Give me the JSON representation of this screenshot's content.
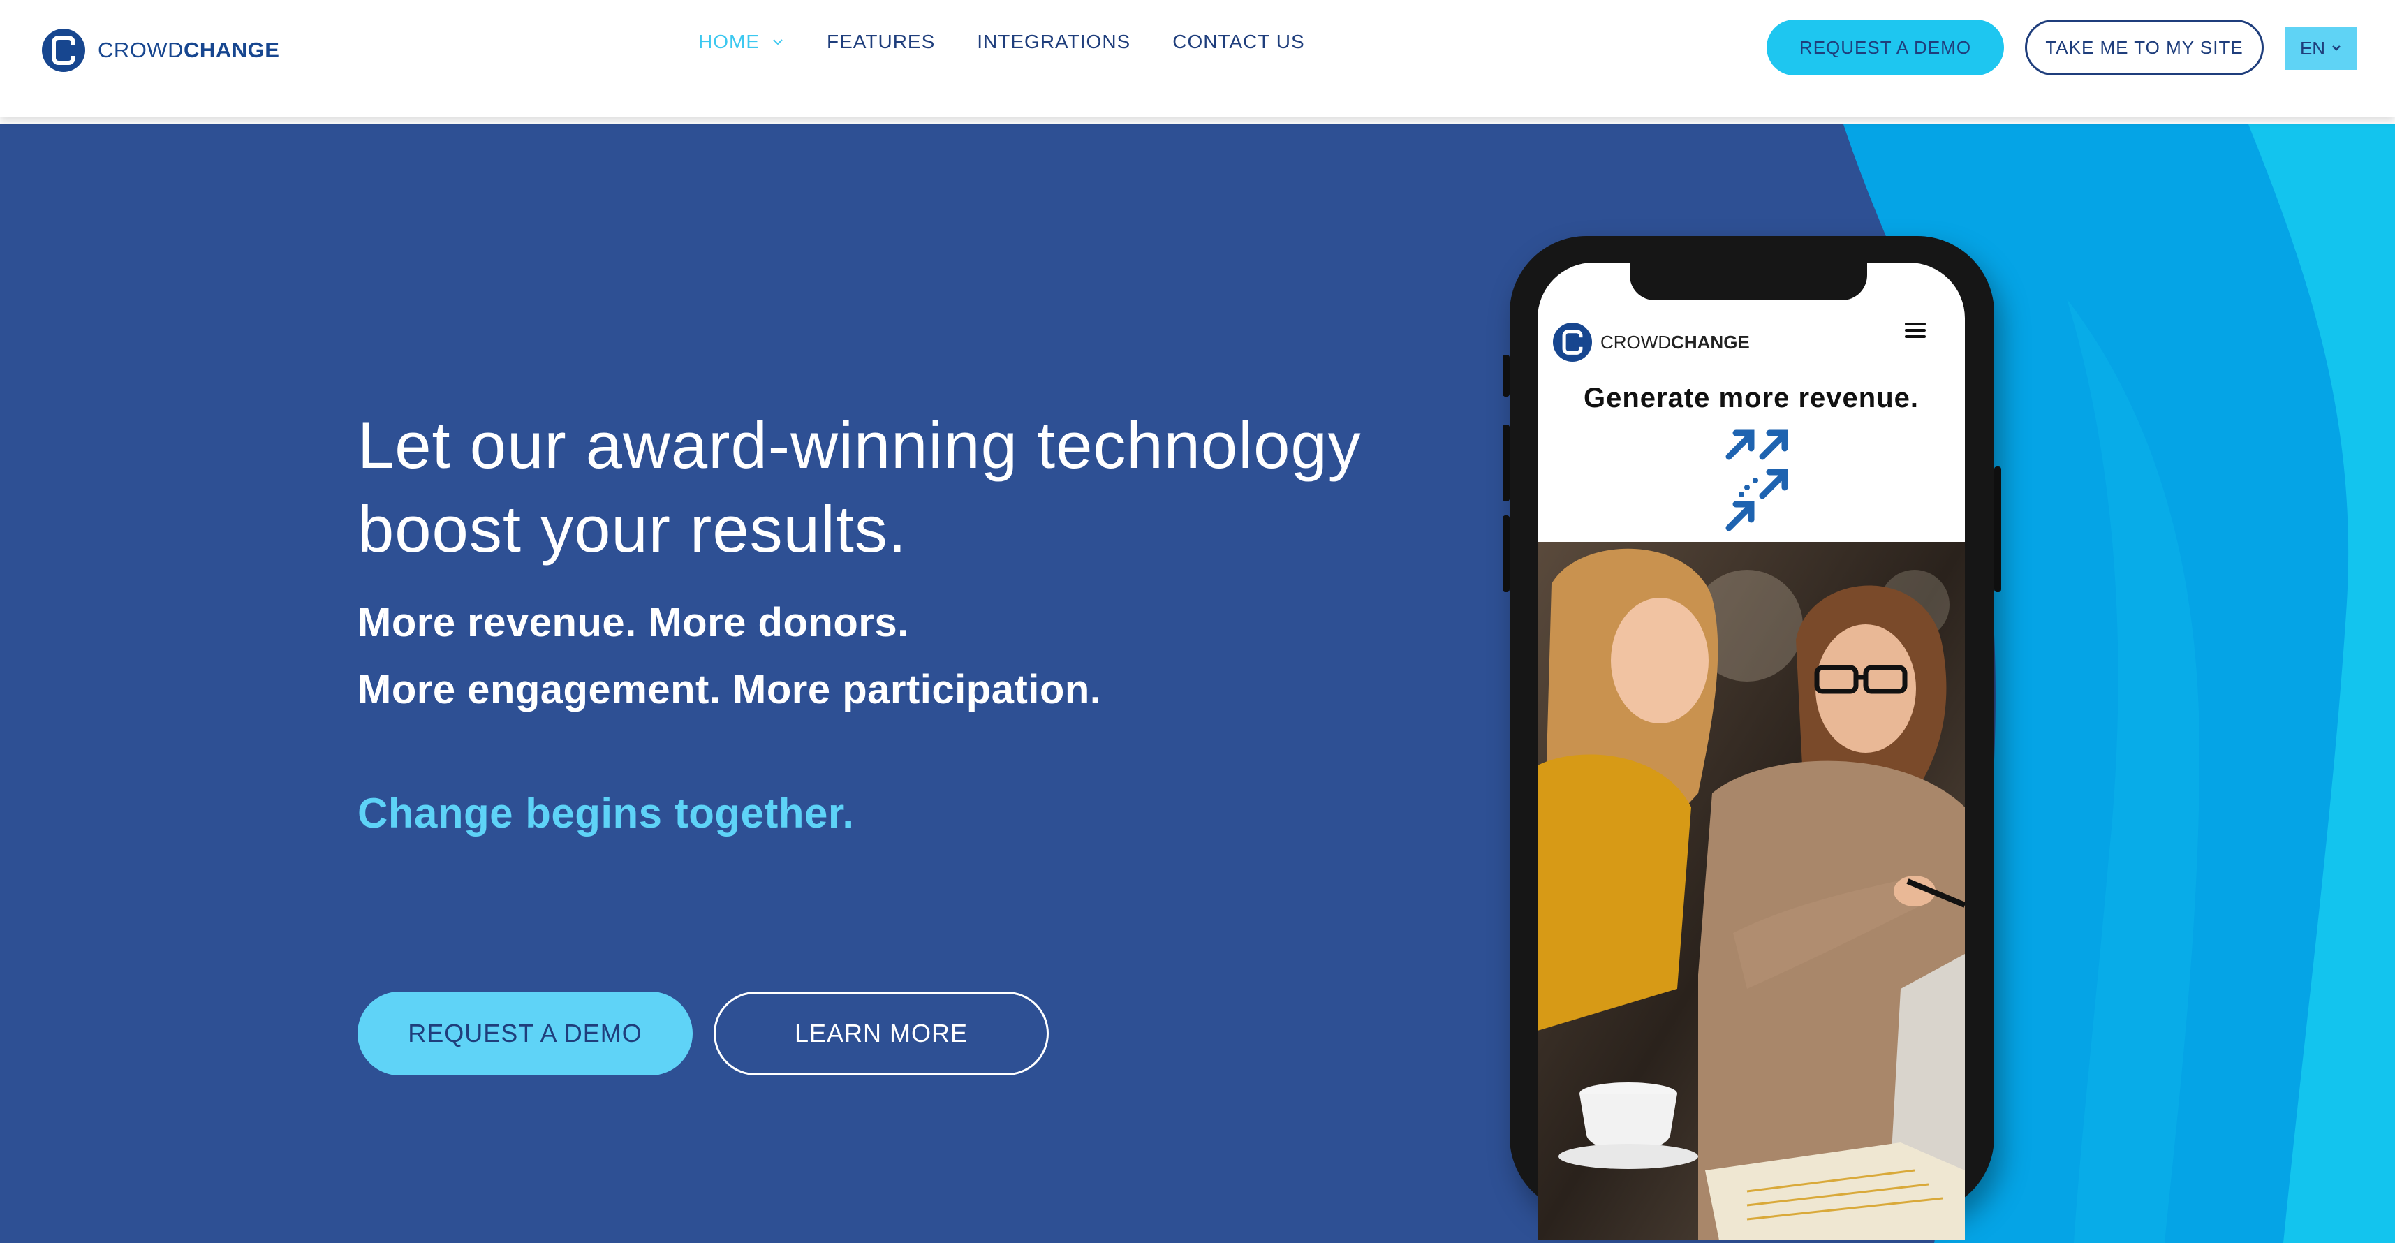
{
  "header": {
    "logo": {
      "word1": "CROWD",
      "word2": "CHANGE"
    },
    "nav": [
      {
        "label": "HOME",
        "active": true,
        "has_dropdown": true
      },
      {
        "label": "FEATURES",
        "active": false
      },
      {
        "label": "INTEGRATIONS",
        "active": false
      },
      {
        "label": "CONTACT US",
        "active": false
      }
    ],
    "request_demo_label": "REQUEST A DEMO",
    "my_site_label": "TAKE ME TO MY SITE",
    "language": "EN"
  },
  "hero": {
    "headline_line1": "Let our award-winning technology",
    "headline_line2": "boost your results.",
    "sub_line1": "More revenue. More donors.",
    "sub_line2": "More engagement. More participation.",
    "tagline": "Change begins together.",
    "primary_button": "REQUEST A DEMO",
    "secondary_button": "LEARN MORE"
  },
  "phone": {
    "logo": {
      "word1": "CROWD",
      "word2": "CHANGE"
    },
    "headline": "Generate more revenue.",
    "icons": [
      "menu-icon",
      "growth-arrows-icon"
    ]
  },
  "colors": {
    "brand_navy": "#1f3e7c",
    "hero_blue": "#2e5094",
    "accent_cyan": "#1ec6f0",
    "light_cyan": "#5fd3f7"
  }
}
